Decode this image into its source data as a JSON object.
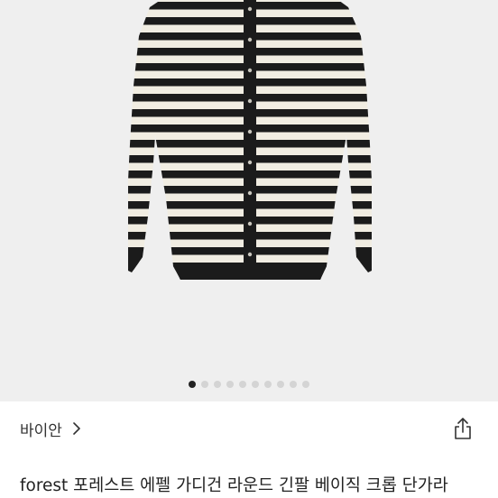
{
  "product_image": {
    "description_icon": "striped-cardigan-photo"
  },
  "carousel": {
    "total": 10,
    "active": 1
  },
  "brand": {
    "name": "바이안",
    "chevron_icon": "chevron-right-icon"
  },
  "share": {
    "icon": "share-icon"
  },
  "product": {
    "title": "forest 포레스트 에펠 가디건 라운드 긴팔 베이직 크롭 단가라"
  },
  "colors": {
    "stripe_dark": "#1b1b1b",
    "stripe_light": "#f1ede2",
    "background": "#efefef"
  }
}
